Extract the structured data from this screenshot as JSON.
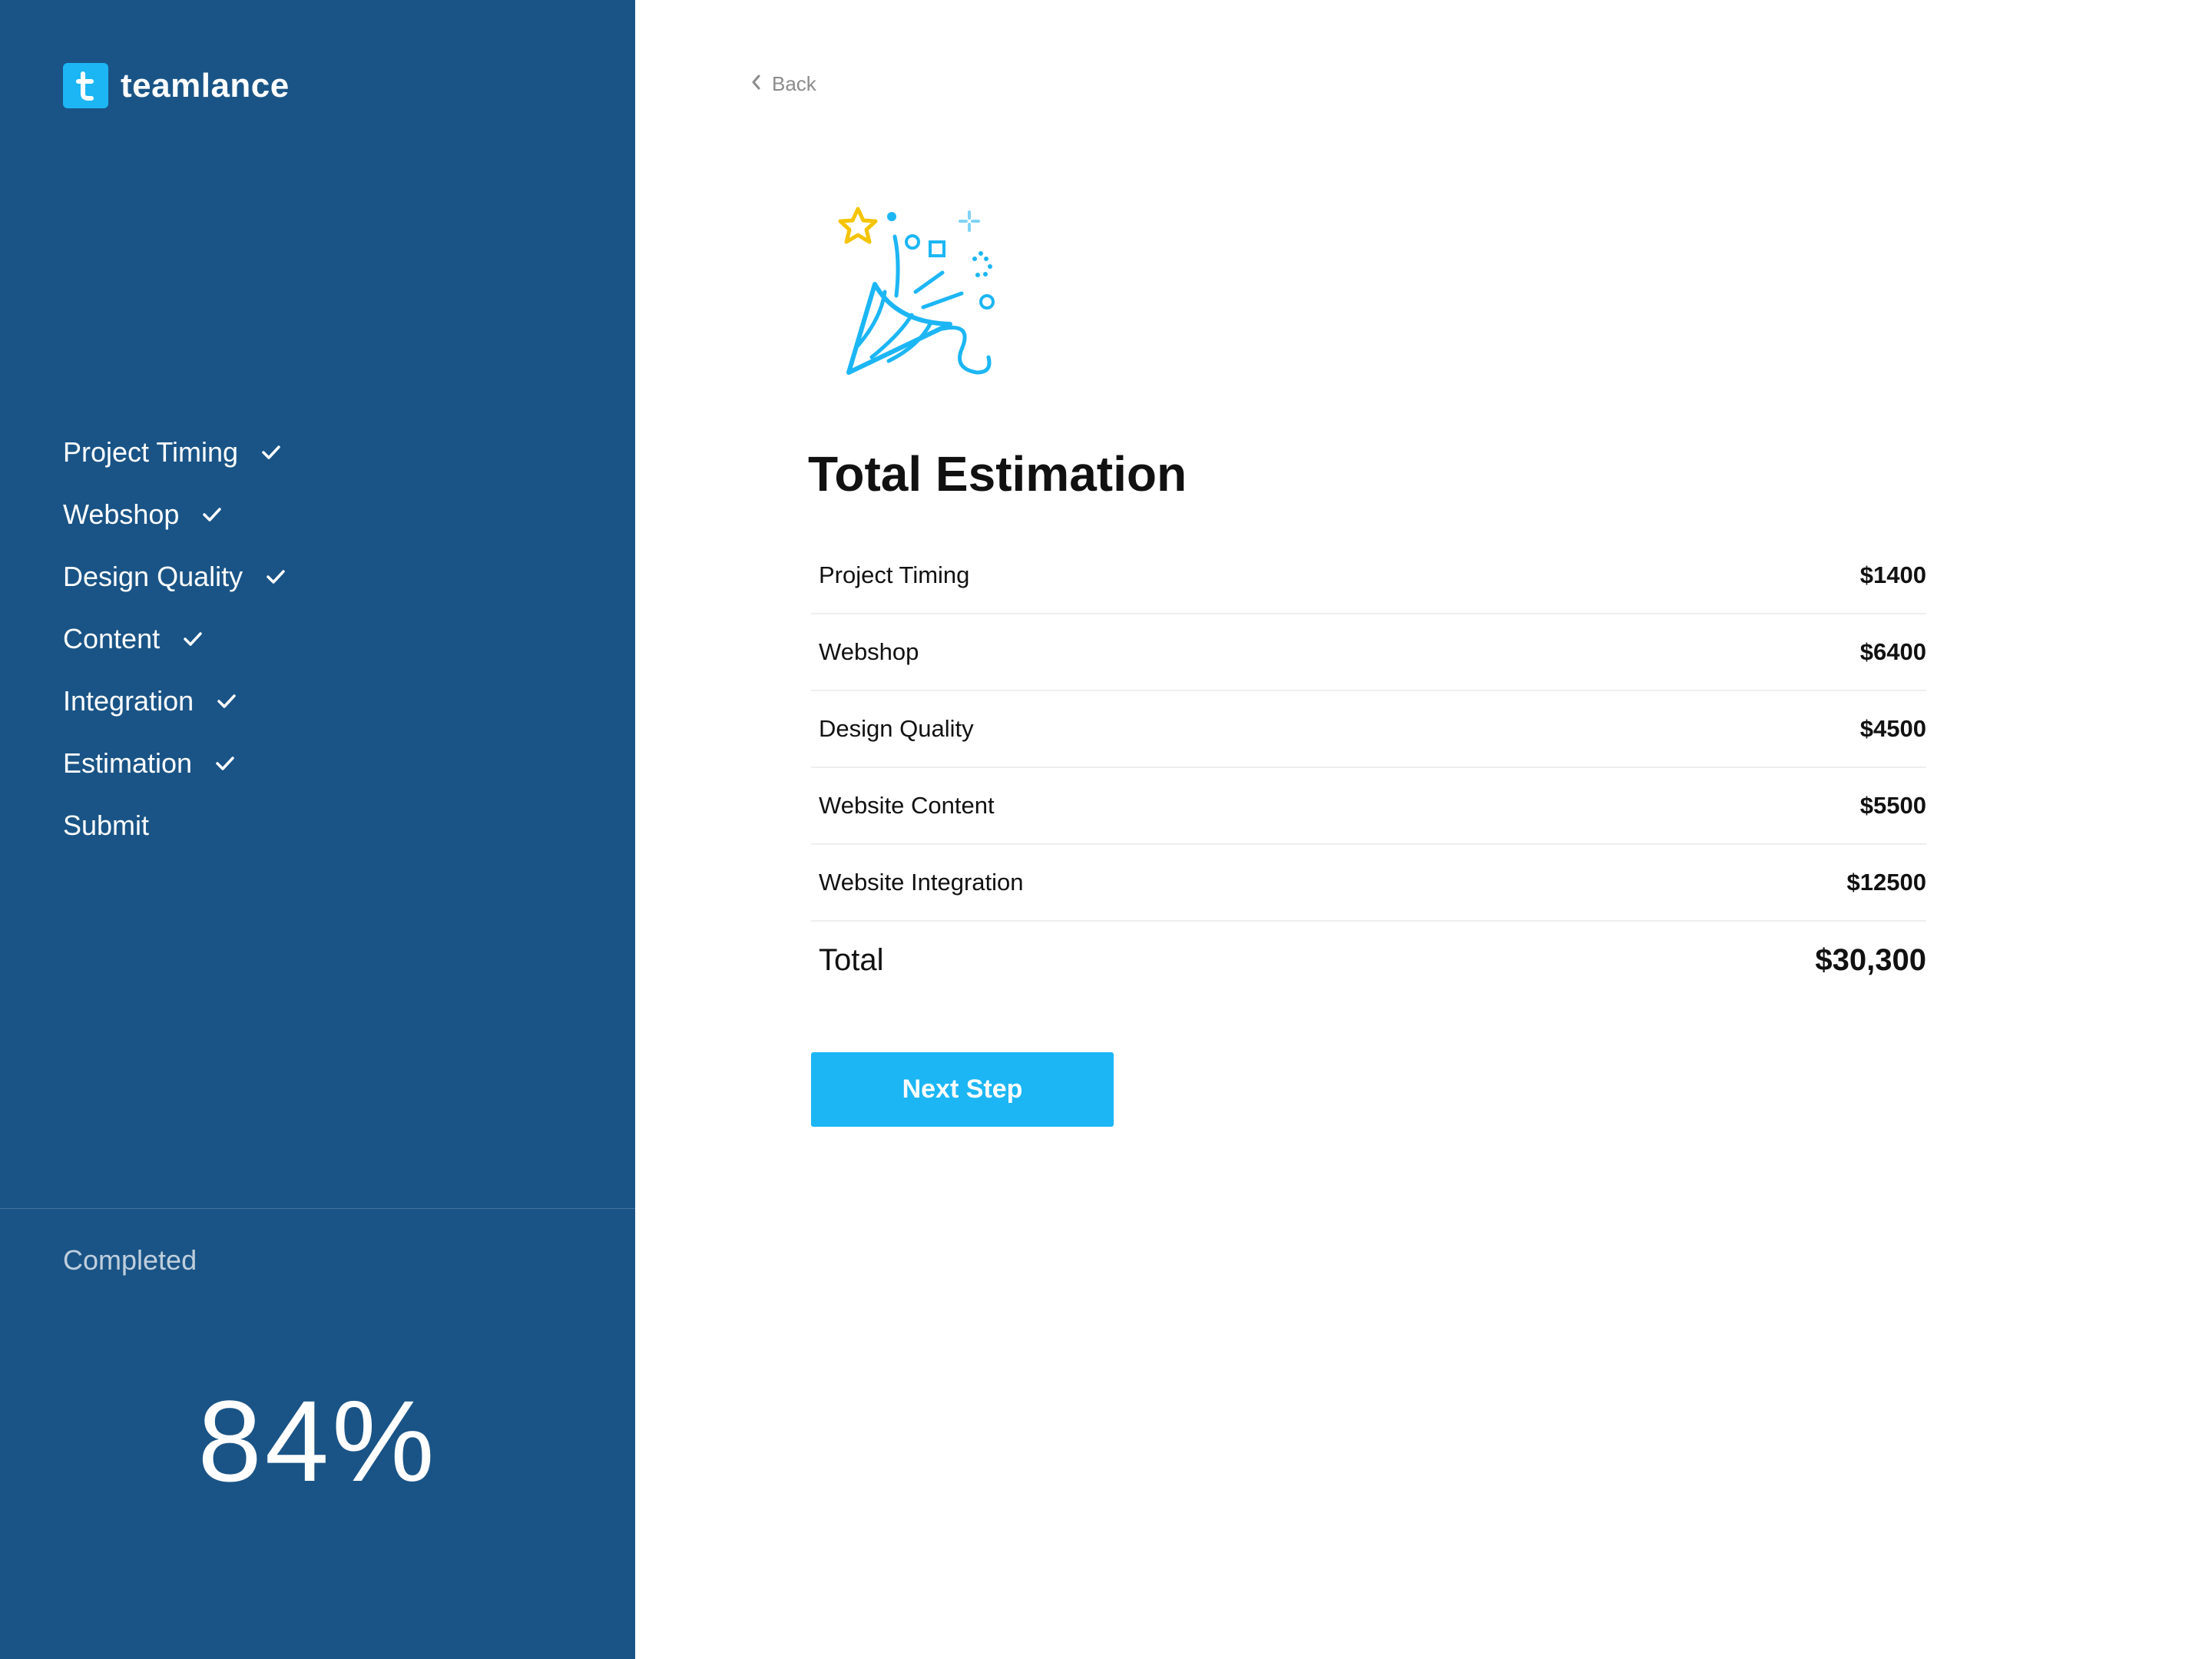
{
  "brand": {
    "name": "teamlance",
    "logo_letter": "t",
    "accent": "#1cb6f5",
    "sidebar_bg": "#1a5486"
  },
  "sidebar": {
    "steps": [
      {
        "label": "Project Timing",
        "done": true
      },
      {
        "label": "Webshop",
        "done": true
      },
      {
        "label": "Design Quality",
        "done": true
      },
      {
        "label": "Content",
        "done": true
      },
      {
        "label": "Integration",
        "done": true
      },
      {
        "label": "Estimation",
        "done": true
      },
      {
        "label": "Submit",
        "done": false
      }
    ],
    "completed_label": "Completed",
    "completed_percent": "84%"
  },
  "main": {
    "back_label": "Back",
    "illustration_icon": "party-popper-icon",
    "title": "Total Estimation",
    "rows": [
      {
        "label": "Project Timing",
        "amount": "$1400"
      },
      {
        "label": "Webshop",
        "amount": "$6400"
      },
      {
        "label": "Design Quality",
        "amount": "$4500"
      },
      {
        "label": "Website Content",
        "amount": "$5500"
      },
      {
        "label": "Website Integration",
        "amount": "$12500"
      }
    ],
    "total": {
      "label": "Total",
      "amount": "$30,300"
    },
    "next_button": "Next Step"
  }
}
